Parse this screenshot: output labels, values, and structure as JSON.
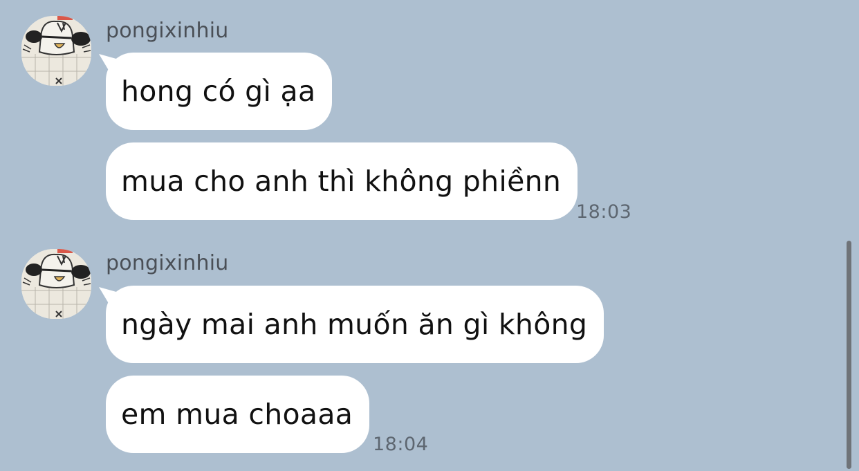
{
  "conversation": {
    "groups": [
      {
        "sender": "pongixinhiu",
        "avatar_icon": "cat-with-sunglasses-avatar-icon",
        "messages": [
          {
            "text": "hong có gì ạa"
          },
          {
            "text": "mua cho anh thì không phiềnn"
          }
        ],
        "time": "18:03"
      },
      {
        "sender": "pongixinhiu",
        "avatar_icon": "cat-with-sunglasses-avatar-icon",
        "messages": [
          {
            "text": "ngày mai anh muốn ăn gì không"
          },
          {
            "text": "em mua choaaa"
          }
        ],
        "time": "18:04"
      }
    ]
  },
  "colors": {
    "background": "#adbfd0",
    "bubble": "#ffffff",
    "scrollbar": "#6f7378"
  }
}
